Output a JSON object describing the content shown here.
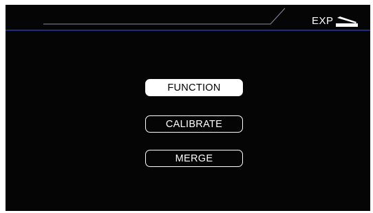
{
  "header": {
    "mode_label": "EXP",
    "mode_icon": "expression-pedal-icon",
    "line_color": "#2a3aa8"
  },
  "menu": {
    "items": [
      {
        "label": "FUNCTION",
        "selected": true
      },
      {
        "label": "CALIBRATE",
        "selected": false
      },
      {
        "label": "MERGE",
        "selected": false
      }
    ]
  },
  "colors": {
    "background": "#050505",
    "foreground": "#ffffff",
    "accent_line": "#2a3aa8"
  }
}
